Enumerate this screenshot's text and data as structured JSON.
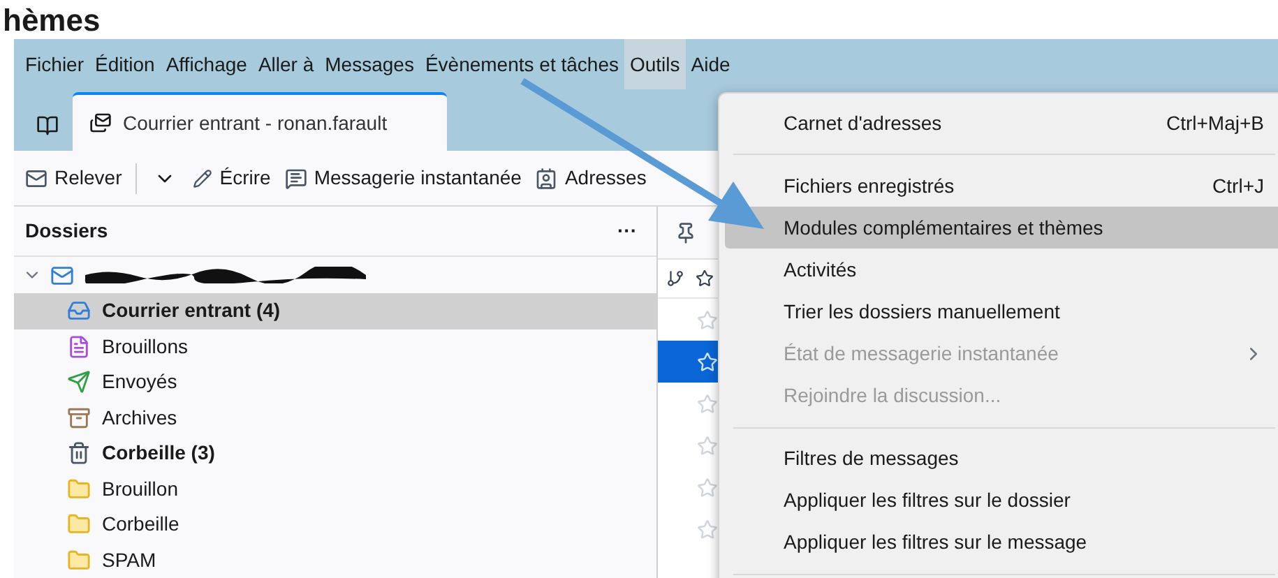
{
  "page_heading": "hèmes",
  "menubar": [
    {
      "label": "Fichier",
      "selected": false
    },
    {
      "label": "Édition",
      "selected": false
    },
    {
      "label": "Affichage",
      "selected": false
    },
    {
      "label": "Aller à",
      "selected": false
    },
    {
      "label": "Messages",
      "selected": false
    },
    {
      "label": "Évènements et tâches",
      "selected": false
    },
    {
      "label": "Outils",
      "selected": true
    },
    {
      "label": "Aide",
      "selected": false
    }
  ],
  "tab": {
    "title": "Courrier entrant - ronan.farault",
    "selected": true
  },
  "toolbar": [
    {
      "kind": "get",
      "label": "Relever"
    },
    {
      "kind": "dropdown"
    },
    {
      "kind": "write",
      "label": "Écrire"
    },
    {
      "kind": "chat",
      "label": "Messagerie instantanée"
    },
    {
      "kind": "contacts",
      "label": "Adresses"
    }
  ],
  "folder_pane": {
    "title": "Dossiers",
    "menu": "···",
    "account": {
      "expanded": true
    },
    "folders": [
      {
        "kind": "inbox",
        "label": "Courrier entrant (4)",
        "unread": true,
        "selected": true
      },
      {
        "kind": "drafts",
        "label": "Brouillons",
        "unread": false,
        "selected": false
      },
      {
        "kind": "sent",
        "label": "Envoyés",
        "unread": false,
        "selected": false
      },
      {
        "kind": "archive",
        "label": "Archives",
        "unread": false,
        "selected": false
      },
      {
        "kind": "trash",
        "label": "Corbeille (3)",
        "unread": true,
        "selected": false
      },
      {
        "kind": "folder",
        "label": "Brouillon",
        "unread": false,
        "selected": false
      },
      {
        "kind": "folder",
        "label": "Corbeille",
        "unread": false,
        "selected": false
      },
      {
        "kind": "folder",
        "label": "SPAM",
        "unread": false,
        "selected": false
      }
    ]
  },
  "message_list": {
    "rows": [
      {
        "selected": false
      },
      {
        "selected": true
      },
      {
        "selected": false
      },
      {
        "selected": false
      },
      {
        "selected": false
      },
      {
        "selected": false
      }
    ]
  },
  "tools_menu": [
    {
      "kind": "item",
      "label": "Carnet d'adresses",
      "shortcut": "Ctrl+Maj+B",
      "disabled": false,
      "selected": false
    },
    {
      "kind": "separator"
    },
    {
      "kind": "item",
      "label": "Fichiers enregistrés",
      "shortcut": "Ctrl+J",
      "disabled": false,
      "selected": false
    },
    {
      "kind": "item",
      "label": "Modules complémentaires et thèmes",
      "disabled": false,
      "selected": true
    },
    {
      "kind": "item",
      "label": "Activités",
      "disabled": false,
      "selected": false
    },
    {
      "kind": "item",
      "label": "Trier les dossiers manuellement",
      "disabled": false,
      "selected": false
    },
    {
      "kind": "submenu",
      "label": "État de messagerie instantanée",
      "disabled": true,
      "selected": false
    },
    {
      "kind": "item",
      "label": "Rejoindre la discussion...",
      "disabled": true,
      "selected": false
    },
    {
      "kind": "separator"
    },
    {
      "kind": "item",
      "label": "Filtres de messages",
      "disabled": false,
      "selected": false
    },
    {
      "kind": "item",
      "label": "Appliquer les filtres sur le dossier",
      "disabled": false,
      "selected": false
    },
    {
      "kind": "item",
      "label": "Appliquer les filtres sur le message",
      "disabled": false,
      "selected": false
    },
    {
      "kind": "separator"
    }
  ]
}
